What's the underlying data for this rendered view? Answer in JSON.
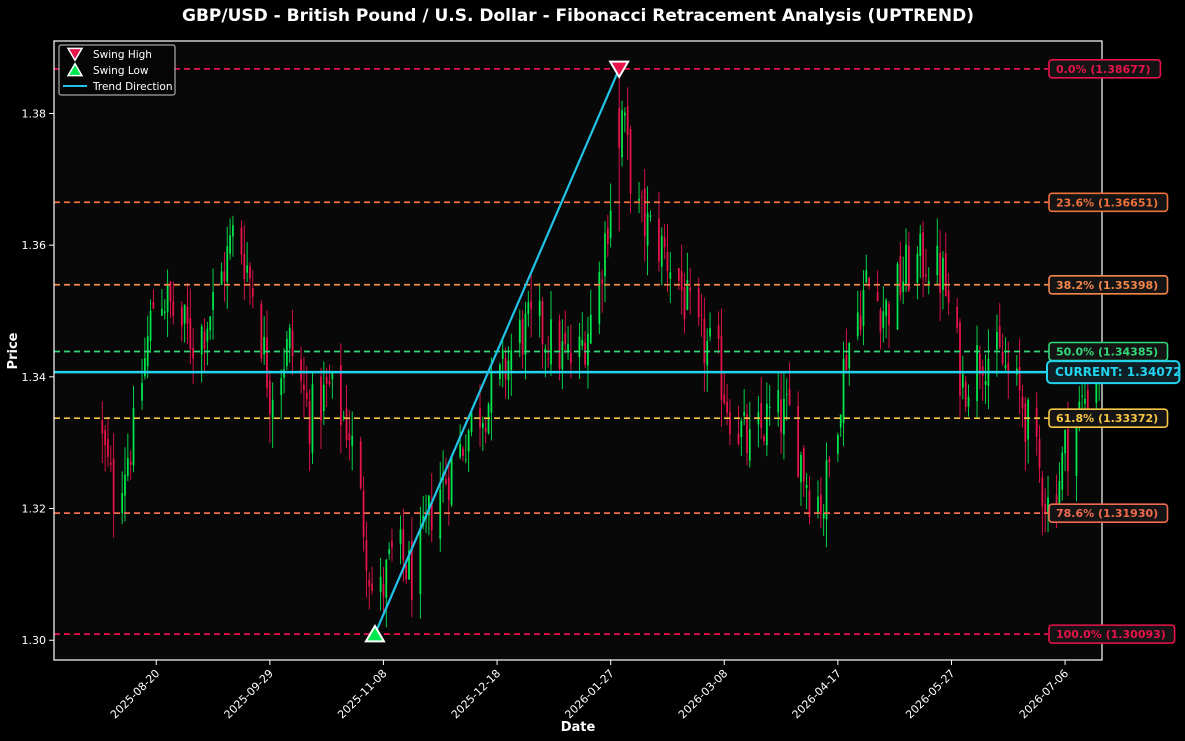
{
  "chart_data": {
    "type": "candlestick",
    "title": "GBP/USD - British Pound / U.S. Dollar - Fibonacci Retracement Analysis (UPTREND)",
    "xlabel": "Date",
    "ylabel": "Price",
    "ylim": [
      1.297,
      1.391
    ],
    "y_ticks": [
      1.3,
      1.32,
      1.34,
      1.36,
      1.38
    ],
    "x_range": [
      "2025-07-15",
      "2026-07-19"
    ],
    "x_ticks": [
      "2025-08-20",
      "2025-09-29",
      "2025-11-08",
      "2025-12-18",
      "2026-01-27",
      "2026-03-08",
      "2026-04-17",
      "2026-05-27",
      "2026-07-06"
    ],
    "grid": false,
    "background": "#080808",
    "colors": {
      "up": "#00e84d",
      "down": "#e8134a",
      "trend": "#22c3e6",
      "current": "#22d3ee"
    },
    "fib_levels": [
      {
        "label": "0.0% (1.38677)",
        "value": 1.38677,
        "color": "#e8134a"
      },
      {
        "label": "23.6% (1.36651)",
        "value": 1.36651,
        "color": "#f0703a"
      },
      {
        "label": "38.2% (1.35398)",
        "value": 1.35398,
        "color": "#f2864b"
      },
      {
        "label": "50.0% (1.34385)",
        "value": 1.34385,
        "color": "#32d979"
      },
      {
        "label": "61.8% (1.33372)",
        "value": 1.33372,
        "color": "#f6c744"
      },
      {
        "label": "78.6% (1.31930)",
        "value": 1.3193,
        "color": "#f26a4f"
      },
      {
        "label": "100.0% (1.30093)",
        "value": 1.30093,
        "color": "#e8134a"
      }
    ],
    "current": {
      "label": "CURRENT: 1.34072",
      "value": 1.34072
    },
    "swing_high": {
      "date": "2026-01-30",
      "price": 1.38677
    },
    "swing_low": {
      "date": "2025-11-05",
      "price": 1.30093
    },
    "legend": {
      "position": "top-left",
      "items": [
        {
          "label": "Swing High",
          "marker": "triangle-down",
          "color": "#e8134a"
        },
        {
          "label": "Swing Low",
          "marker": "triangle-up",
          "color": "#00e84d"
        },
        {
          "label": "Trend Direction",
          "marker": "line",
          "color": "#22c3e6"
        }
      ]
    },
    "anchors": [
      [
        "2025-07-30",
        1.334
      ],
      [
        "2025-08-05",
        1.322
      ],
      [
        "2025-08-12",
        1.331
      ],
      [
        "2025-08-20",
        1.354
      ],
      [
        "2025-08-27",
        1.349
      ],
      [
        "2025-09-03",
        1.345
      ],
      [
        "2025-09-10",
        1.352
      ],
      [
        "2025-09-17",
        1.363
      ],
      [
        "2025-09-24",
        1.352
      ],
      [
        "2025-09-29",
        1.338
      ],
      [
        "2025-10-06",
        1.345
      ],
      [
        "2025-10-13",
        1.334
      ],
      [
        "2025-10-20",
        1.338
      ],
      [
        "2025-10-27",
        1.332
      ],
      [
        "2025-11-01",
        1.318
      ],
      [
        "2025-11-05",
        1.304
      ],
      [
        "2025-11-12",
        1.314
      ],
      [
        "2025-11-19",
        1.309
      ],
      [
        "2025-11-26",
        1.322
      ],
      [
        "2025-12-03",
        1.327
      ],
      [
        "2025-12-10",
        1.334
      ],
      [
        "2025-12-18",
        1.338
      ],
      [
        "2025-12-25",
        1.346
      ],
      [
        "2026-01-01",
        1.348
      ],
      [
        "2026-01-08",
        1.344
      ],
      [
        "2026-01-15",
        1.342
      ],
      [
        "2026-01-22",
        1.352
      ],
      [
        "2026-01-27",
        1.367
      ],
      [
        "2026-01-30",
        1.383
      ],
      [
        "2026-02-05",
        1.365
      ],
      [
        "2026-02-12",
        1.361
      ],
      [
        "2026-02-19",
        1.356
      ],
      [
        "2026-02-26",
        1.346
      ],
      [
        "2026-03-05",
        1.343
      ],
      [
        "2026-03-10",
        1.335
      ],
      [
        "2026-03-17",
        1.329
      ],
      [
        "2026-03-24",
        1.334
      ],
      [
        "2026-03-31",
        1.334
      ],
      [
        "2026-04-07",
        1.323
      ],
      [
        "2026-04-12",
        1.321
      ],
      [
        "2026-04-20",
        1.344
      ],
      [
        "2026-04-27",
        1.354
      ],
      [
        "2026-05-04",
        1.35
      ],
      [
        "2026-05-11",
        1.356
      ],
      [
        "2026-05-18",
        1.358
      ],
      [
        "2026-05-24",
        1.355
      ],
      [
        "2026-05-31",
        1.339
      ],
      [
        "2026-06-07",
        1.344
      ],
      [
        "2026-06-14",
        1.342
      ],
      [
        "2026-06-21",
        1.336
      ],
      [
        "2026-06-26",
        1.327
      ],
      [
        "2026-07-01",
        1.319
      ],
      [
        "2026-07-06",
        1.329
      ],
      [
        "2026-07-13",
        1.337
      ],
      [
        "2026-07-18",
        1.341
      ]
    ]
  }
}
